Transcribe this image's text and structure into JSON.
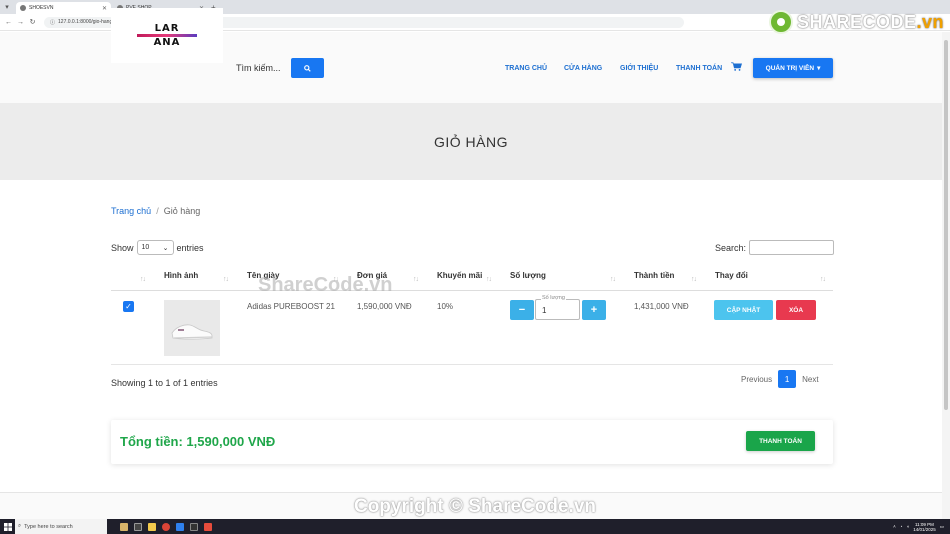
{
  "browser": {
    "tabs": [
      {
        "title": "SHOESVN",
        "active": true
      },
      {
        "title": "PVE SHOP",
        "active": false
      }
    ],
    "url": "127.0.0.1:8000/gio-hang"
  },
  "watermark": {
    "brand": "SHARECODE",
    "brand_suffix": ".vn",
    "middle": "ShareCode.vn",
    "copyright": "Copyright © ShareCode.vn"
  },
  "header": {
    "logo": {
      "line1": "LAR",
      "line2": "ANA"
    },
    "search_placeholder": "Tìm kiếm...",
    "nav": [
      "TRANG CHỦ",
      "CỬA HÀNG",
      "GIỚI THIỆU",
      "THANH TOÁN"
    ],
    "admin_label": "QUẢN TRỊ VIÊN"
  },
  "hero": {
    "title": "GIỎ HÀNG"
  },
  "breadcrumb": {
    "home": "Trang chủ",
    "separator": "/",
    "current": "Giỏ hàng"
  },
  "table": {
    "length": {
      "show": "Show",
      "value": "10",
      "entries": "entries"
    },
    "search_label": "Search:",
    "columns": [
      "Hình ảnh",
      "Tên giày",
      "Đơn giá",
      "Khuyến mãi",
      "Số lượng",
      "Thành tiền",
      "Thay đổi"
    ],
    "rows": [
      {
        "checked": true,
        "name": "Adidas PUREBOOST 21",
        "price": "1,590,000 VNĐ",
        "discount": "10%",
        "qty_label": "Số lượng",
        "qty": "1",
        "total": "1,431,000 VNĐ",
        "update_label": "CẬP NHẬT",
        "delete_label": "XÓA"
      }
    ],
    "info": "Showing 1 to 1 of 1 entries",
    "pagination": {
      "previous": "Previous",
      "page": "1",
      "next": "Next"
    }
  },
  "summary": {
    "total_text": "Tổng tiền: 1,590,000 VNĐ",
    "checkout_label": "THANH TOÁN"
  },
  "taskbar": {
    "search_placeholder": "Type here to search",
    "time": "11:09 PM",
    "date": "14/01/2025"
  },
  "colors": {
    "primary": "#1877f2",
    "info": "#3bb0e8",
    "danger": "#e8394f",
    "success": "#1aa54a"
  }
}
